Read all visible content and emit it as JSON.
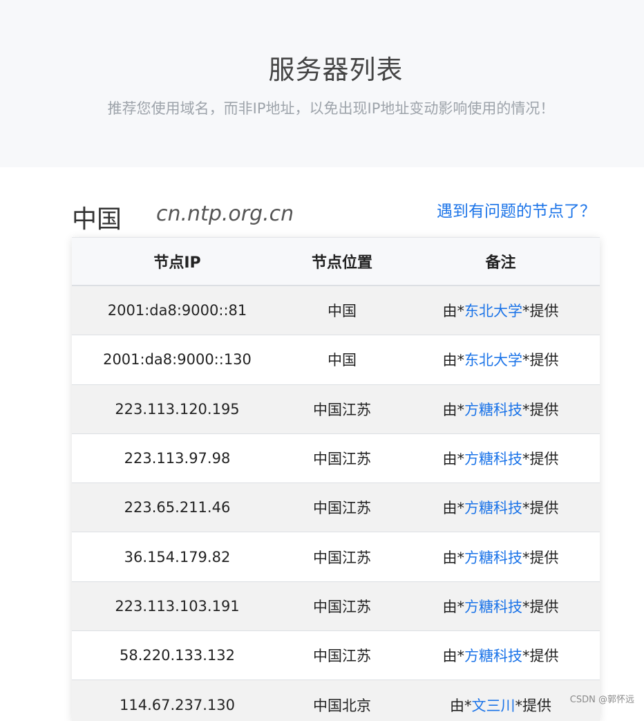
{
  "hero": {
    "title": "服务器列表",
    "subtitle": "推荐您使用域名，而非IP地址，以免出现IP地址变动影响使用的情况！"
  },
  "region": {
    "name": "中国",
    "domain": "cn.ntp.org.cn",
    "report_link": "遇到有问题的节点了？"
  },
  "table": {
    "headers": [
      "节点IP",
      "节点位置",
      "备注"
    ],
    "note_prefix": "由*",
    "note_suffix": "*提供",
    "rows": [
      {
        "ip": "2001:da8:9000::81",
        "location": "中国",
        "provider": "东北大学"
      },
      {
        "ip": "2001:da8:9000::130",
        "location": "中国",
        "provider": "东北大学"
      },
      {
        "ip": "223.113.120.195",
        "location": "中国江苏",
        "provider": "方糖科技"
      },
      {
        "ip": "223.113.97.98",
        "location": "中国江苏",
        "provider": "方糖科技"
      },
      {
        "ip": "223.65.211.46",
        "location": "中国江苏",
        "provider": "方糖科技"
      },
      {
        "ip": "36.154.179.82",
        "location": "中国江苏",
        "provider": "方糖科技"
      },
      {
        "ip": "223.113.103.191",
        "location": "中国江苏",
        "provider": "方糖科技"
      },
      {
        "ip": "58.220.133.132",
        "location": "中国江苏",
        "provider": "方糖科技"
      },
      {
        "ip": "114.67.237.130",
        "location": "中国北京",
        "provider": "文三川"
      }
    ]
  },
  "watermark": "CSDN @郭怀远",
  "colors": {
    "link": "#1a73e8",
    "hero_bg": "#f7f8fa",
    "row_stripe": "#f2f2f2"
  }
}
